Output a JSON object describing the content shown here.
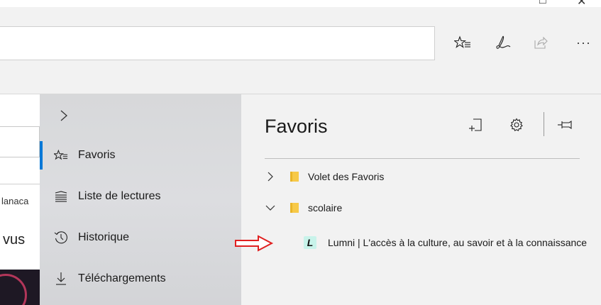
{
  "window": {
    "controls": [
      {
        "name": "maximize",
        "glyph": "□"
      },
      {
        "name": "close",
        "glyph": "✕"
      }
    ]
  },
  "address_bar": {
    "value": ""
  },
  "toolbar_icons": [
    "favorites-star-icon",
    "pen-icon",
    "share-icon",
    "more-icon"
  ],
  "more_glyph": "···",
  "page_fragments": {
    "text1": "lanaca",
    "text2": "vus"
  },
  "hub": {
    "items": [
      {
        "label": "Favoris",
        "icon": "favorites-star-icon",
        "active": true
      },
      {
        "label": "Liste de lectures",
        "icon": "reading-list-icon",
        "active": false
      },
      {
        "label": "Historique",
        "icon": "history-icon",
        "active": false
      },
      {
        "label": "Téléchargements",
        "icon": "download-icon",
        "active": false
      }
    ]
  },
  "favorites": {
    "title": "Favoris",
    "tree": [
      {
        "label": "Volet des Favoris",
        "expanded": false,
        "type": "folder"
      },
      {
        "label": "scolaire",
        "expanded": true,
        "type": "folder"
      },
      {
        "label": "Lumni | L'accès à la culture, au savoir et à la connaissance",
        "type": "link",
        "favicon": "L"
      }
    ]
  },
  "colors": {
    "accent": "#0078d7",
    "folder": "#f7c948",
    "favicon_bg": "#c8f3ea",
    "annotation_arrow": "#e02020"
  }
}
